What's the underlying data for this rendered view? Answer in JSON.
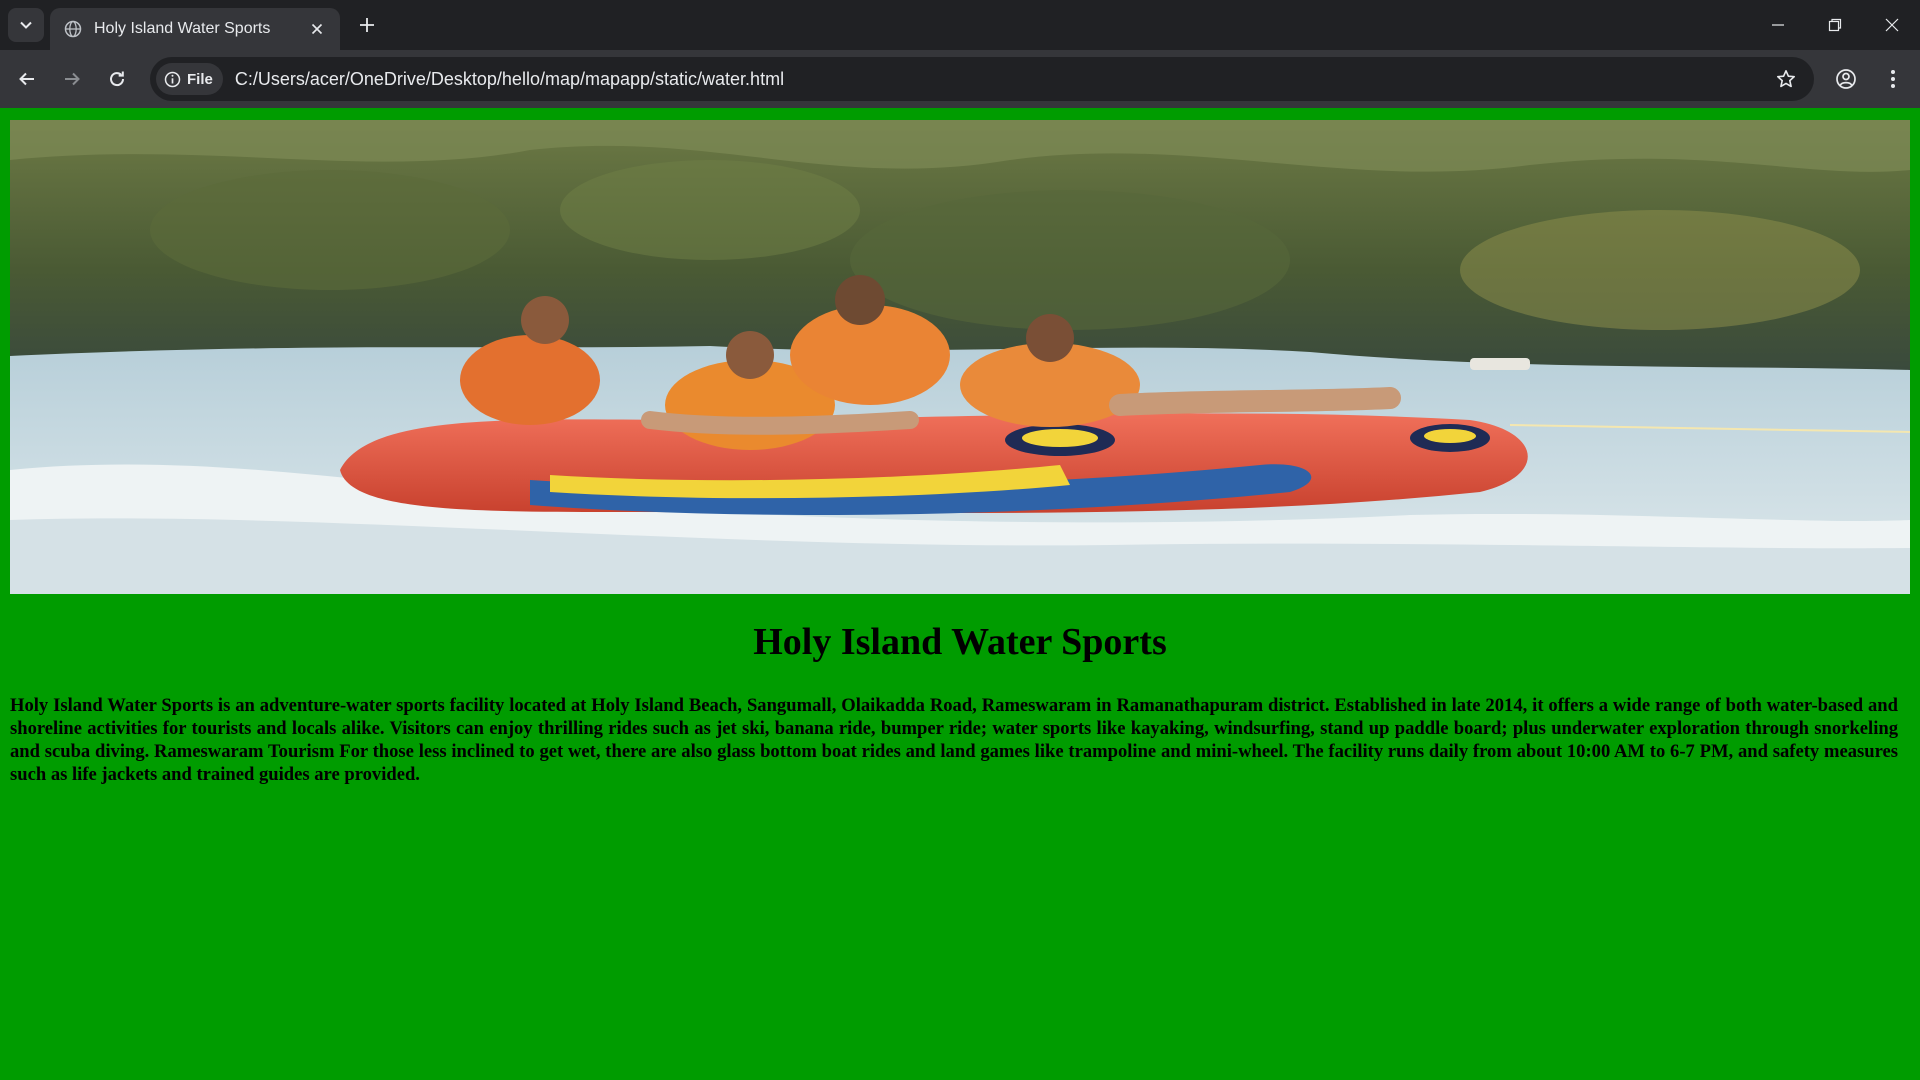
{
  "browser": {
    "tab": {
      "title": "Holy Island Water Sports",
      "favicon": "globe-icon"
    },
    "address_bar": {
      "chip_label": "File",
      "url": "C:/Users/acer/OneDrive/Desktop/hello/map/mapapp/static/water.html"
    },
    "icons": [
      "tab-search-icon",
      "close-icon",
      "new-tab-icon",
      "minimize-icon",
      "restore-icon",
      "close-window-icon",
      "back-arrow-icon",
      "forward-arrow-icon",
      "reload-icon",
      "info-icon",
      "star-icon",
      "profile-icon",
      "kebab-menu-icon"
    ]
  },
  "page": {
    "background_color": "#009c00",
    "title": "Holy Island Water Sports",
    "description": "Holy Island Water Sports is an adventure-water sports facility located at Holy Island Beach, Sangumall, Olaikadda Road, Rameswaram in Ramanathapuram district. Established in late 2014, it offers a wide range of both water-based and shoreline activities for tourists and locals alike. Visitors can enjoy thrilling rides such as jet ski, banana ride, bumper ride; water sports like kayaking, windsurfing, stand up paddle board; plus underwater exploration through snorkeling and scuba diving. Rameswaram Tourism For those less inclined to get wet, there are also glass bottom boat rides and land games like trampoline and mini-wheel. The facility runs daily from about 10:00 AM to 6-7 PM, and safety measures such as life jackets and trained guides are provided."
  }
}
